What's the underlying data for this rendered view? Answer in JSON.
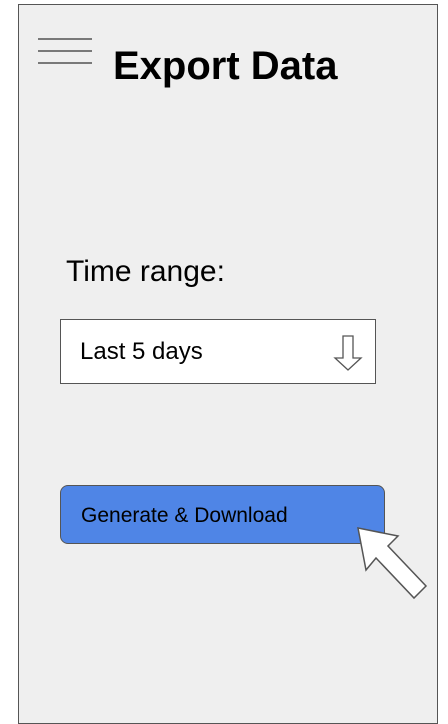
{
  "header": {
    "menu_icon": "hamburger-menu-icon",
    "title": "Export Data"
  },
  "form": {
    "time_range_label": "Time range:",
    "time_range_select": {
      "selected": "Last 5 days",
      "arrow_icon": "arrow-down-icon"
    },
    "generate_button_label": "Generate & Download"
  },
  "pointer": {
    "icon": "mouse-pointer-icon"
  },
  "colors": {
    "background": "#efefef",
    "button": "#4f85e6",
    "border": "#555555"
  }
}
